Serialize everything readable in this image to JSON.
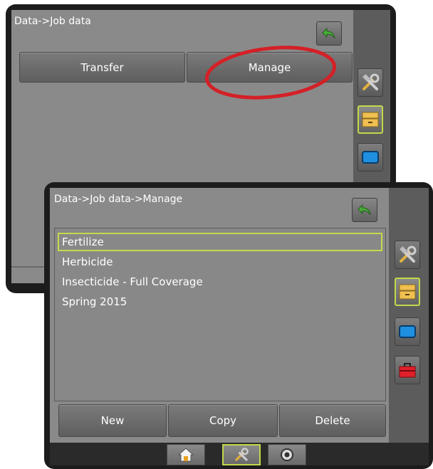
{
  "back_screen": {
    "title": "Data->Job data",
    "tabs": [
      "Transfer",
      "Manage"
    ]
  },
  "front_screen": {
    "title": "Data->Job data->Manage",
    "jobs": [
      "Fertilize",
      "Herbicide",
      "Insecticide - Full Coverage",
      "Spring 2015"
    ],
    "selected_job": "Fertilize",
    "actions": [
      "New",
      "Copy",
      "Delete"
    ]
  },
  "colors": {
    "highlight": "#c6d94a",
    "annotation_circle": "#d42027",
    "back_arrow": "#4caf3c"
  },
  "icons": {
    "side": [
      "tools-icon",
      "data-drawer-icon",
      "display-icon",
      "toolbox-icon"
    ],
    "bottom_nav": [
      "home-icon",
      "tools-icon",
      "gps-target-icon"
    ]
  }
}
